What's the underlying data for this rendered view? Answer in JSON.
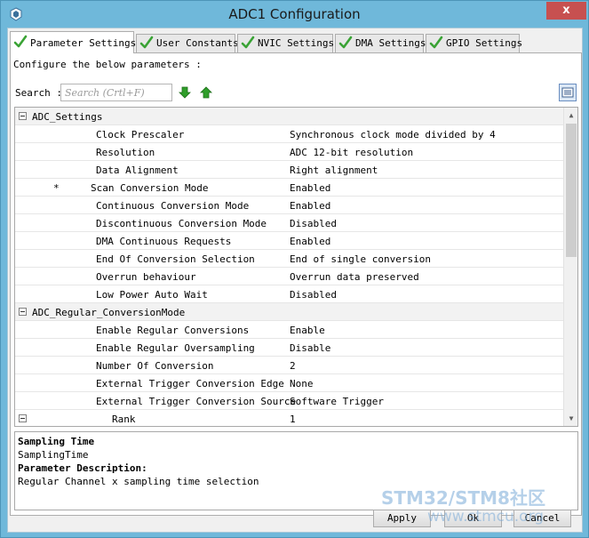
{
  "window": {
    "title": "ADC1 Configuration",
    "close_glyph": "x"
  },
  "tabs": [
    {
      "label": "Parameter Settings",
      "active": true
    },
    {
      "label": "User Constants",
      "active": false
    },
    {
      "label": "NVIC Settings",
      "active": false
    },
    {
      "label": "DMA Settings",
      "active": false
    },
    {
      "label": "GPIO Settings",
      "active": false
    }
  ],
  "panel": {
    "prompt": "Configure the below parameters :",
    "search_label": "Search :",
    "search_placeholder": "Search (Crtl+F)",
    "search_value": ""
  },
  "grid": {
    "groups": [
      {
        "name": "ADC_Settings",
        "rows": [
          {
            "name": "Clock Prescaler",
            "value": "Synchronous clock mode divided by 4"
          },
          {
            "name": "Resolution",
            "value": "ADC 12-bit resolution"
          },
          {
            "name": "Data Alignment",
            "value": "Right alignment"
          },
          {
            "name": "Scan Conversion Mode",
            "value": "Enabled",
            "marker": "*"
          },
          {
            "name": "Continuous Conversion Mode",
            "value": "Enabled"
          },
          {
            "name": "Discontinuous Conversion Mode",
            "value": "Disabled"
          },
          {
            "name": "DMA Continuous Requests",
            "value": "Enabled"
          },
          {
            "name": "End Of Conversion Selection",
            "value": "End of single conversion"
          },
          {
            "name": "Overrun behaviour",
            "value": "Overrun data preserved"
          },
          {
            "name": "Low Power Auto Wait",
            "value": "Disabled"
          }
        ]
      },
      {
        "name": "ADC_Regular_ConversionMode",
        "rows": [
          {
            "name": "Enable Regular Conversions",
            "value": "Enable"
          },
          {
            "name": "Enable Regular Oversampling",
            "value": "Disable"
          },
          {
            "name": "Number Of Conversion",
            "value": "2"
          },
          {
            "name": "External Trigger Conversion Edge",
            "value": "None"
          },
          {
            "name": "External Trigger Conversion Source",
            "value": "Software Trigger"
          },
          {
            "name": "Rank",
            "value": "1"
          }
        ]
      }
    ]
  },
  "description": {
    "title": "Sampling Time",
    "name": "SamplingTime",
    "heading": "Parameter Description:",
    "text": "Regular Channel x sampling time selection"
  },
  "buttons": {
    "apply": "Apply",
    "ok": "Ok",
    "cancel": "Cancel"
  },
  "watermark": {
    "line1": "STM32/STM8社区",
    "line2": "www.stmcu.org"
  },
  "colors": {
    "check_green": "#3aa335",
    "arrow_green": "#2f9e2a",
    "close_red": "#c75050"
  },
  "icons": {
    "tab_check": "check-icon",
    "search_next": "arrow-down-icon",
    "search_prev": "arrow-up-icon",
    "view_toggle": "list-view-icon",
    "group_toggle": "collapse-icon"
  }
}
